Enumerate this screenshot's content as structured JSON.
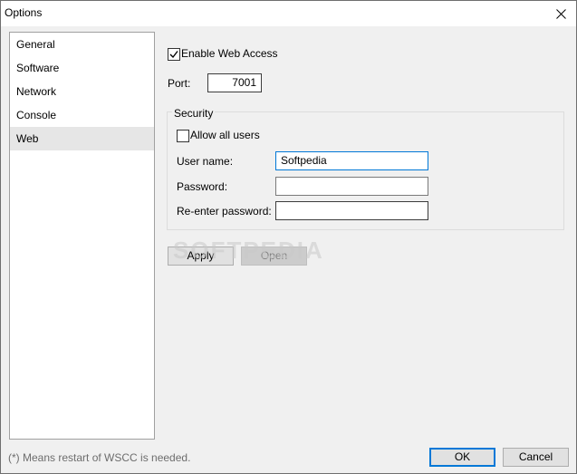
{
  "window": {
    "title": "Options"
  },
  "sidebar": {
    "items": [
      {
        "label": "General"
      },
      {
        "label": "Software"
      },
      {
        "label": "Network"
      },
      {
        "label": "Console"
      },
      {
        "label": "Web",
        "selected": true
      }
    ]
  },
  "web": {
    "enable_label": "Enable Web Access",
    "enable_checked": true,
    "port_label": "Port:",
    "port_value": "7001",
    "security": {
      "title": "Security",
      "allow_all_label": "Allow all users",
      "allow_all_checked": false,
      "username_label": "User name:",
      "username_value": "Softpedia",
      "password_label": "Password:",
      "password_value": "",
      "reenter_label": "Re-enter password:",
      "reenter_value": ""
    },
    "apply_label": "Apply",
    "open_label": "Open",
    "watermark": "SOFTPEDIA"
  },
  "footer": {
    "note": "(*) Means restart of WSCC is needed.",
    "ok_label": "OK",
    "cancel_label": "Cancel"
  },
  "colors": {
    "focus_border": "#0078d7",
    "selected_item": "#e6e6e6"
  }
}
